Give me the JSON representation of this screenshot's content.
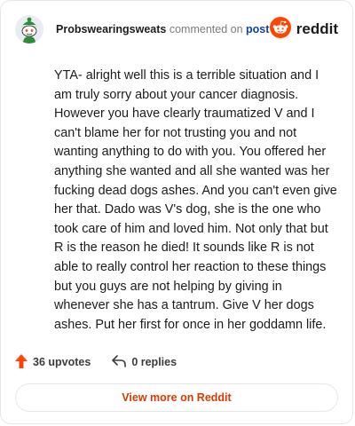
{
  "header": {
    "username": "Probswearingsweats",
    "commented_on": "commented on",
    "post_link": "post",
    "brand_name": "reddit"
  },
  "comment": {
    "text": "YTA- alright well this is a terrible situation and I am truly sorry about your cancer diagnosis. However you have clearly traumatized V and I can't blame her for not trusting you and not wanting anything to do with you. You offered her anything she wanted and all she wanted was her fucking dead dogs ashes. And you can't even give her that. Dado was V's dog, she is the one who took care of him and loved him. Not only that but R is the reason he died! It sounds like R is not able to really control her reaction to these things but you guys are not helping by giving in whenever she has a tantrum. Give V her dogs ashes. Put her first for once in her goddamn life."
  },
  "actions": {
    "upvotes_label": "36 upvotes",
    "replies_label": "0 replies"
  },
  "footer": {
    "view_more_label": "View more on Reddit"
  },
  "colors": {
    "brand_orange": "#ff4500",
    "link_blue": "#0a449b",
    "button_text": "#d93a00",
    "border": "#e5e7eb"
  },
  "icons": {
    "avatar": "snoo-avatar-icon",
    "brand": "reddit-logo-icon",
    "upvote": "upvote-arrow-icon",
    "reply": "reply-arrow-icon"
  }
}
